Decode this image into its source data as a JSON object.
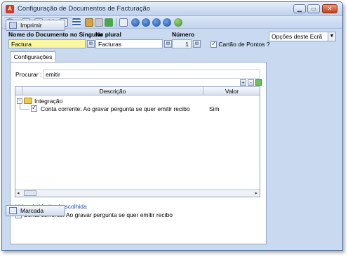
{
  "window": {
    "title": "Configuração de Documentos de Facturação",
    "app_icon_letter": "A"
  },
  "toolbar": {
    "icons": [
      "new-icon",
      "copy-icon",
      "delete-icon",
      "edit-icon",
      "list-icon",
      "print-icon",
      "preview-icon",
      "refresh-icon",
      "search-icon",
      "nav-first-icon",
      "nav-prev-icon",
      "nav-next-icon",
      "nav-last-icon",
      "help-icon"
    ]
  },
  "form": {
    "singular_label": "Nome do Documento no Singular",
    "singular_value": "Factura",
    "plural_label": "No plural",
    "plural_value": "Facturas",
    "number_label": "Número",
    "number_value": "1",
    "points_card_label": "Cartão de Pontos ?"
  },
  "tabs": {
    "active_label": "Configurações"
  },
  "search": {
    "label": "Procurar :",
    "value": "emitir"
  },
  "grid": {
    "col_descricao": "Descrição",
    "col_valor": "Valor",
    "group_label": "Integração",
    "row_label": "Conta corrente: Ao gravar pergunta se quer emitir recibo",
    "row_value": "Sim"
  },
  "selected_value": {
    "caption": "Valor da Variável escolhida",
    "checkbox_label": "Conta corrente: Ao gravar pergunta se quer emitir recibo"
  },
  "sidebar": {
    "options_label": "Opções deste Ecrã",
    "print_button": "Imprimir",
    "marcada_button": "Marcada"
  },
  "colors": {
    "window_bg": "#c9daf0",
    "required_field": "#fbf6a0",
    "link_blue": "#1f4fb3"
  }
}
